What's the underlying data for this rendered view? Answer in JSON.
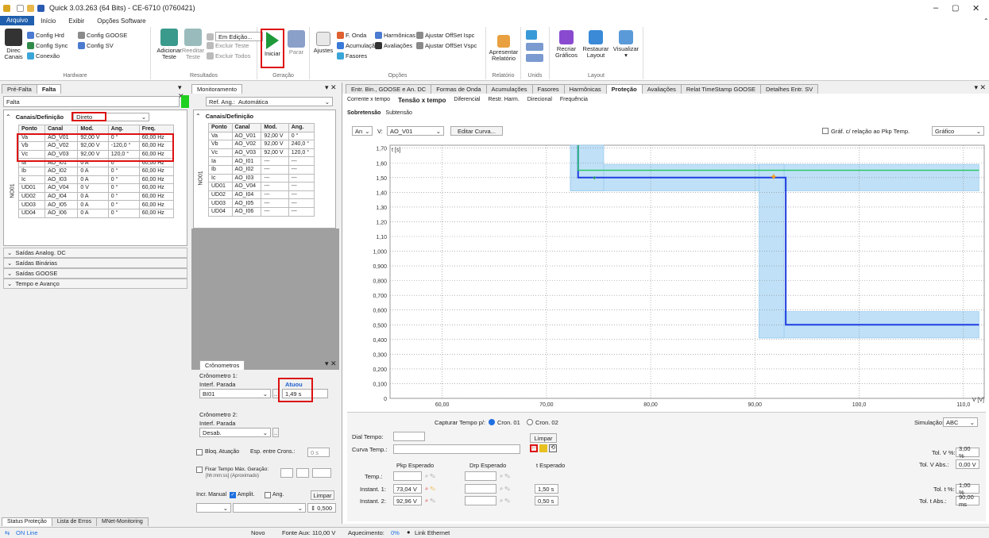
{
  "window": {
    "title": "Quick 3.03.263 (64 Bits) - CE-6710 (0760421)"
  },
  "menu": [
    "Arquivo",
    "Início",
    "Exibir",
    "Opções Software"
  ],
  "ribbon": {
    "hardware": {
      "label": "Hardware",
      "config_hrd": "Config Hrd",
      "config_goose": "Config GOOSE",
      "config_sync": "Config Sync",
      "config_sv": "Config SV",
      "direc": "Direc",
      "canais": "Canais",
      "conexao": "Conexão"
    },
    "resultados": {
      "label": "Resultados",
      "adicionar": "Adicionar",
      "teste": "Teste",
      "reeditar": "Reeditar",
      "teste2": "Teste",
      "em_edicao": "Em Edição...",
      "excluir_teste": "Excluir Teste",
      "excluir_todos": "Excluir Todos"
    },
    "geracao": {
      "label": "Geração",
      "iniciar": "Iniciar",
      "parar": "Parar"
    },
    "opcoes": {
      "label": "Opções",
      "ajustes": "Ajustes",
      "f_onda": "F. Onda",
      "acumulacao": "Acumulação",
      "fasores": "Fasores",
      "harmonicas": "Harmônicas",
      "avaliacoes": "Avaliações",
      "ajustar_ispc": "Ajustar OffSet Ispc",
      "ajustar_vspc": "Ajustar OffSet Vspc"
    },
    "relatorio": {
      "label": "Relatório",
      "apresentar": "Apresentar",
      "relatorio": "Relatório"
    },
    "unids": {
      "label": "Unids"
    },
    "layout": {
      "label": "Layout",
      "recriar": "Recriar",
      "graficos": "Gráficos",
      "restaurar": "Restaurar",
      "layout": "Layout",
      "visualizar": "Visualizar"
    }
  },
  "left_panel": {
    "tabs": [
      "Pré-Falta",
      "Falta"
    ],
    "state": "Falta",
    "section_title": "Canais/Definição",
    "mode": "Direto",
    "group": "NO01",
    "headers": [
      "Ponto",
      "Canal",
      "Mod.",
      "Ang.",
      "Freq."
    ],
    "rows": [
      [
        "Va",
        "AO_V01",
        "92,00 V",
        "0 °",
        "60,00 Hz"
      ],
      [
        "Vb",
        "AO_V02",
        "92,00 V",
        "-120,0 °",
        "60,00 Hz"
      ],
      [
        "Vc",
        "AO_V03",
        "92,00 V",
        "120,0 °",
        "60,00 Hz"
      ],
      [
        "Ia",
        "AO_I01",
        "0 A",
        "0 °",
        "60,00 Hz"
      ],
      [
        "Ib",
        "AO_I02",
        "0 A",
        "0 °",
        "60,00 Hz"
      ],
      [
        "Ic",
        "AO_I03",
        "0 A",
        "0 °",
        "60,00 Hz"
      ],
      [
        "UD01",
        "AO_V04",
        "0 V",
        "0 °",
        "60,00 Hz"
      ],
      [
        "UD02",
        "AO_I04",
        "0 A",
        "0 °",
        "60,00 Hz"
      ],
      [
        "UD03",
        "AO_I05",
        "0 A",
        "0 °",
        "60,00 Hz"
      ],
      [
        "UD04",
        "AO_I06",
        "0 A",
        "0 °",
        "60,00 Hz"
      ]
    ],
    "sections": [
      "Saídas Analog. DC",
      "Saídas Binárias",
      "Saídas GOOSE",
      "Tempo e Avanço"
    ]
  },
  "monitor": {
    "title": "Monitoramento",
    "ref_ang_label": "Ref. Ang.:",
    "ref_ang_value": "Automática",
    "section_title": "Canais/Definição",
    "group": "NO01",
    "headers": [
      "Ponto",
      "Canal",
      "Mod.",
      "Ang."
    ],
    "rows": [
      [
        "Va",
        "AO_V01",
        "92,00 V",
        "0 °"
      ],
      [
        "Vb",
        "AO_V02",
        "92,00 V",
        "240,0 °"
      ],
      [
        "Vc",
        "AO_V03",
        "92,00 V",
        "120,0 °"
      ],
      [
        "Ia",
        "AO_I01",
        "---",
        "---"
      ],
      [
        "Ib",
        "AO_I02",
        "---",
        "---"
      ],
      [
        "Ic",
        "AO_I03",
        "---",
        "---"
      ],
      [
        "UD01",
        "AO_V04",
        "---",
        "---"
      ],
      [
        "UD02",
        "AO_I04",
        "---",
        "---"
      ],
      [
        "UD03",
        "AO_I05",
        "---",
        "---"
      ],
      [
        "UD04",
        "AO_I06",
        "---",
        "---"
      ]
    ]
  },
  "crono": {
    "title": "Crônometros",
    "c1_label": "Crônometro 1:",
    "c1_interf": "Interf. Parada",
    "c1_value": "BI01",
    "status_label": "Atuou",
    "time": "1,49 s",
    "c2_label": "Crônometro 2:",
    "c2_interf": "Interf. Parada",
    "c2_value": "Desab.",
    "bloq": "Bloq. Atuação",
    "esp": "Esp. entre Crons.:",
    "esp_value": "0 s",
    "fixar": "Fixar Tempo Máx. Geração:",
    "fixar_hint": "[hh:mm:ss] (Aproximado)",
    "incr": "Incr. Manual",
    "amplit": "Amplit.",
    "ang": "Ang.",
    "limpar": "Limpar",
    "step": "0,500"
  },
  "main": {
    "tabs": [
      "Entr. Bin., GOOSE e An. DC",
      "Formas de Onda",
      "Acumulações",
      "Fasores",
      "Harmônicas",
      "Proteção",
      "Avaliações",
      "Relat TimeStamp GOOSE",
      "Detalhes Entr. SV"
    ],
    "active_tab": "Proteção",
    "subtabs": [
      "Corrente x tempo",
      "Tensão x tempo",
      "Diferencial",
      "Restr. Harm.",
      "Direcional",
      "Frequência"
    ],
    "active_subtab": "Tensão x tempo",
    "subsubtabs": [
      "Sobretensão",
      "Subtensão"
    ],
    "an_label": "An",
    "v_label": "V:",
    "v_value": "AO_V01",
    "editar": "Editar Curva...",
    "graf_label": "Gráf. c/ relação ao Pkp Temp.",
    "graf_value": "Gráfico"
  },
  "chart_data": {
    "type": "line",
    "ylabel": "t [s]",
    "xlabel": "V [V]",
    "xlim": [
      55,
      112
    ],
    "ylim": [
      0,
      1.72
    ],
    "yticks": [
      "0",
      "0,100",
      "0,200",
      "0,300",
      "0,400",
      "0,500",
      "0,600",
      "0,700",
      "0,800",
      "0,900",
      "1,000",
      "1,10",
      "1,20",
      "1,30",
      "1,40",
      "1,50",
      "1,60",
      "1,70"
    ],
    "xticks": [
      [
        "60,00",
        60
      ],
      [
        "70,00",
        70
      ],
      [
        "80,00",
        80
      ],
      [
        "90,00",
        90
      ],
      [
        "100,0",
        100
      ],
      [
        "110,0",
        110
      ]
    ],
    "tolerance_bands": [
      {
        "x": [
          72.3,
          111.5
        ],
        "y": [
          1.41,
          1.59
        ]
      },
      {
        "x": [
          72.3,
          75.5
        ],
        "y": [
          1.41,
          1.72
        ]
      },
      {
        "x": [
          90.4,
          111.5
        ],
        "y": [
          0.41,
          0.59
        ]
      },
      {
        "x": [
          90.4,
          92.8
        ],
        "y": [
          0.41,
          1.59
        ]
      }
    ],
    "series": [
      {
        "color": "#1f3fe0",
        "points": [
          [
            73.04,
            1.72
          ],
          [
            73.04,
            1.5
          ],
          [
            92.96,
            1.5
          ],
          [
            92.96,
            0.5
          ],
          [
            111.5,
            0.5
          ]
        ]
      },
      {
        "color": "#22c55e",
        "points": [
          [
            73.04,
            1.72
          ],
          [
            73.04,
            1.55
          ],
          [
            111.5,
            1.55
          ]
        ]
      }
    ],
    "markers": [
      {
        "x": 74.6,
        "y": 1.5,
        "color": "#22a05a",
        "shape": "star"
      },
      {
        "x": 91.8,
        "y": 1.5,
        "color": "#f0a020",
        "shape": "star"
      }
    ]
  },
  "bottom": {
    "capturar": "Capturar Tempo p/:",
    "cron01": "Cron. 01",
    "cron02": "Cron. 02",
    "simulacao_label": "Simulação:",
    "simulacao": "ABC",
    "dial": "Dial Tempo:",
    "limpar": "Limpar",
    "curva": "Curva Temp.:",
    "pkp": "Pkp Esperado",
    "drp": "Drp Esperado",
    "t_esp": "t Esperado",
    "temp": "Temp.:",
    "inst1": "Instant. 1:",
    "inst1_v": "73,04 V",
    "inst1_t": "1,50 s",
    "inst2": "Instant. 2:",
    "inst2_v": "92,96 V",
    "inst2_t": "0,50 s",
    "tol_v": "Tol. V %:",
    "tol_v_val": "3,00 %",
    "tol_vabs": "Tol. V Abs.:",
    "tol_vabs_val": "0,00 V",
    "tol_t": "Tol. t %:",
    "tol_t_val": "1,00 %",
    "tol_tabs": "Tol. t Abs.:",
    "tol_tabs_val": "90,00 ms"
  },
  "status": {
    "tabs": [
      "Status Proteção",
      "Lista de Erros",
      "MNet-Monitoring"
    ],
    "online": "ON Line",
    "novo": "Novo",
    "fonte": "Fonte Aux: 110,00 V",
    "aquec": "Aquecimento:",
    "aquec_val": "0%",
    "link": "Link Ethernet"
  }
}
